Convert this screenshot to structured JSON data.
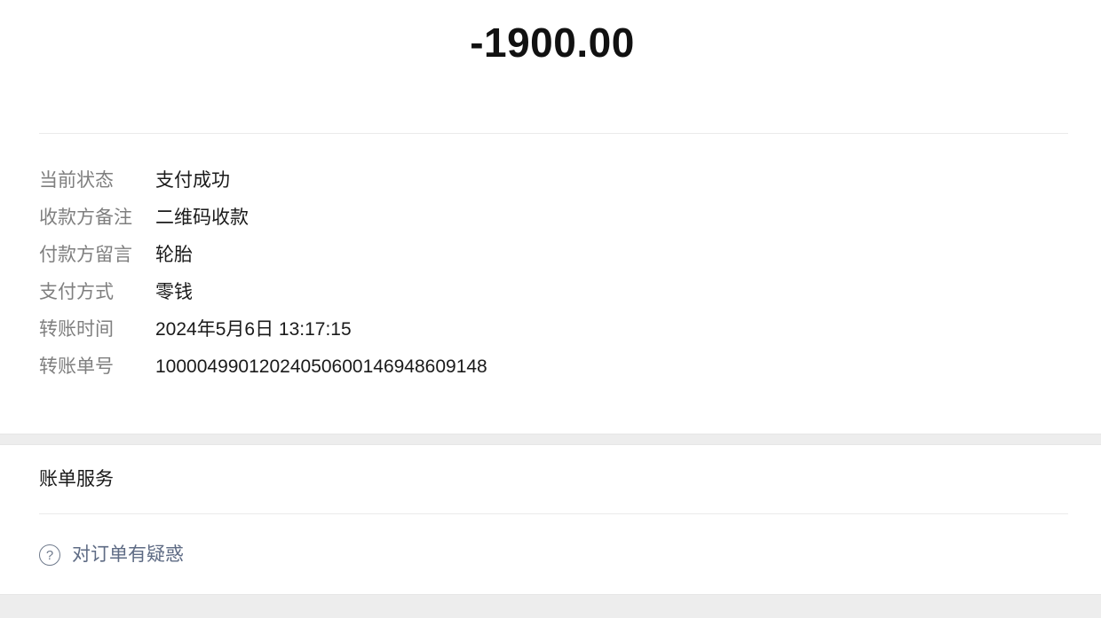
{
  "amount": "-1900.00",
  "details": [
    {
      "label": "当前状态",
      "value": "支付成功"
    },
    {
      "label": "收款方备注",
      "value": "二维码收款"
    },
    {
      "label": "付款方留言",
      "value": "轮胎"
    },
    {
      "label": "支付方式",
      "value": "零钱"
    },
    {
      "label": "转账时间",
      "value": "2024年5月6日 13:17:15"
    },
    {
      "label": "转账单号",
      "value": "10000499012024050600146948609148"
    }
  ],
  "bill_service": {
    "title": "账单服务",
    "help_icon": "question-circle-icon",
    "help_text": "对订单有疑惑"
  },
  "colors": {
    "label_gray": "#7f7f7f",
    "value_black": "#1a1a1a",
    "help_link": "#5e6b84",
    "band_gray": "#ededed"
  }
}
